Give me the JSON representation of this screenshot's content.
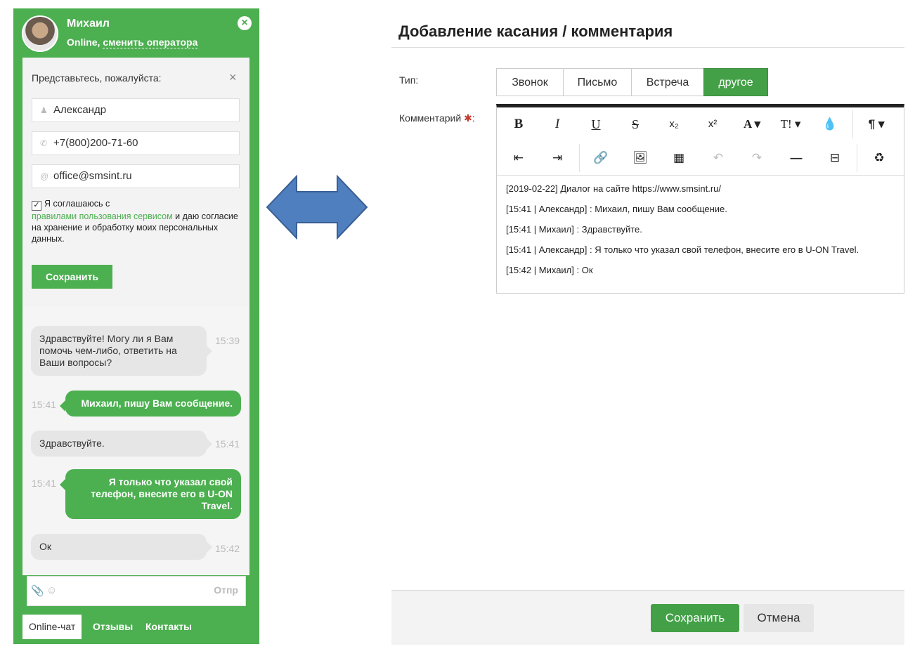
{
  "widget": {
    "operator_name": "Михаил",
    "status": "Online,",
    "change_operator": "сменить оператора",
    "close_icon": "close-icon",
    "form": {
      "title": "Представьтесь, пожалуйста:",
      "name_value": "Александр",
      "phone_value": "+7(800)200-71-60",
      "email_value": "office@smsint.ru",
      "agree_prefix": "Я соглашаюсь с",
      "agree_link": "правилами пользования сервисом",
      "agree_suffix": "и даю согласие на хранение и обработку моих персональных данных.",
      "save_label": "Сохранить"
    },
    "messages": [
      {
        "from": "operator",
        "text": "Здравствуйте! Могу ли я Вам помочь чем-либо, ответить на Ваши вопросы?",
        "time": "15:39"
      },
      {
        "from": "user",
        "text": "Михаил, пишу Вам сообщение.",
        "time": "15:41"
      },
      {
        "from": "operator",
        "text": "Здравствуйте.",
        "time": "15:41"
      },
      {
        "from": "user",
        "text": "Я только что указал свой телефон, внесите его в U-ON Travel.",
        "time": "15:41"
      },
      {
        "from": "operator",
        "text": "Ок",
        "time": "15:42"
      }
    ],
    "compose_send": "Отпр",
    "tabs": [
      "Online-чат",
      "Отзывы",
      "Контакты"
    ]
  },
  "dialog": {
    "title": "Добавление касания / комментария",
    "type_label": "Тип:",
    "type_options": [
      "Звонок",
      "Письмо",
      "Встреча",
      "другое"
    ],
    "type_selected": "другое",
    "comment_label": "Комментарий",
    "comment_lines": [
      "[2019-02-22] Диалог на сайте https://www.smsint.ru/",
      "[15:41 | Александр] : Михаил, пишу Вам сообщение.",
      "[15:41 | Михаил] : Здравствуйте.",
      "[15:41 | Александр] : Я только что указал свой телефон, внесите его в U-ON Travel.",
      "[15:42 | Михаил] : Ок"
    ],
    "save_label": "Сохранить",
    "cancel_label": "Отмена"
  },
  "colors": {
    "accent_green": "#4caf50",
    "button_green": "#43a047",
    "arrow_fill": "#4f7fbf"
  }
}
